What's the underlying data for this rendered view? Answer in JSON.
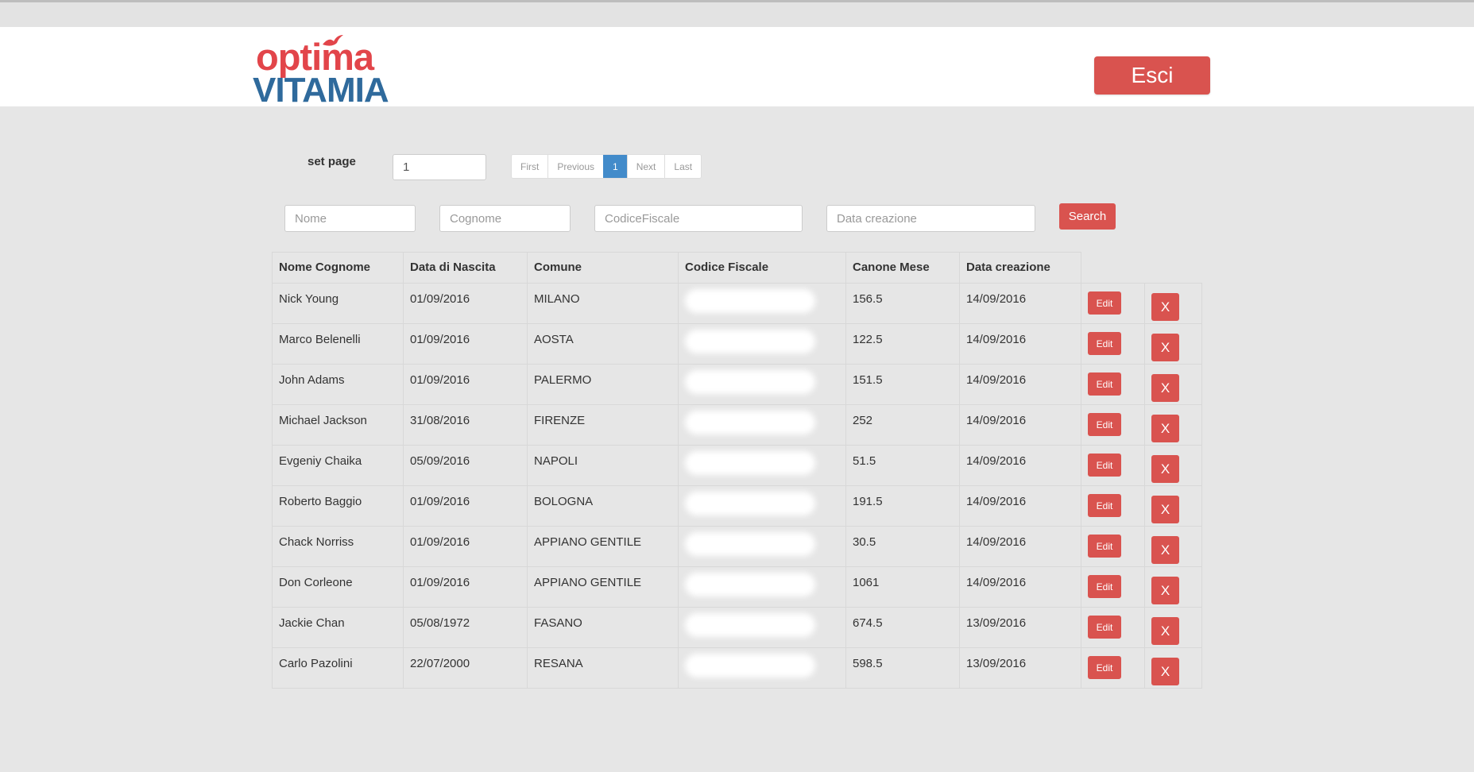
{
  "header": {
    "logo_top": "optima",
    "logo_bottom": "VITAMIA",
    "logout_label": "Esci",
    "colors": {
      "brand_red": "#e2454a",
      "brand_blue": "#2f6a9c",
      "button_red": "#d9534f"
    }
  },
  "pager": {
    "set_page_label": "set page",
    "page_input_value": "1",
    "buttons": [
      "First",
      "Previous",
      "1",
      "Next",
      "Last"
    ],
    "active": "1"
  },
  "filters": {
    "nome_placeholder": "Nome",
    "cognome_placeholder": "Cognome",
    "cf_placeholder": "CodiceFiscale",
    "data_placeholder": "Data creazione",
    "search_label": "Search"
  },
  "table": {
    "columns": [
      "Nome Cognome",
      "Data di Nascita",
      "Comune",
      "Codice Fiscale",
      "Canone Mese",
      "Data creazione"
    ],
    "edit_label": "Edit",
    "delete_label": "X",
    "rows": [
      {
        "name": "Nick Young",
        "birth": "01/09/2016",
        "comune": "MILANO",
        "canone": "156.5",
        "created": "14/09/2016"
      },
      {
        "name": "Marco Belenelli",
        "birth": "01/09/2016",
        "comune": "AOSTA",
        "canone": "122.5",
        "created": "14/09/2016"
      },
      {
        "name": "John Adams",
        "birth": "01/09/2016",
        "comune": "PALERMO",
        "canone": "151.5",
        "created": "14/09/2016"
      },
      {
        "name": "Michael Jackson",
        "birth": "31/08/2016",
        "comune": "FIRENZE",
        "canone": "252",
        "created": "14/09/2016"
      },
      {
        "name": "Evgeniy Chaika",
        "birth": "05/09/2016",
        "comune": "NAPOLI",
        "canone": "51.5",
        "created": "14/09/2016"
      },
      {
        "name": "Roberto Baggio",
        "birth": "01/09/2016",
        "comune": "BOLOGNA",
        "canone": "191.5",
        "created": "14/09/2016"
      },
      {
        "name": "Chack Norriss",
        "birth": "01/09/2016",
        "comune": "APPIANO GENTILE",
        "canone": "30.5",
        "created": "14/09/2016"
      },
      {
        "name": "Don Corleone",
        "birth": "01/09/2016",
        "comune": "APPIANO GENTILE",
        "canone": "1061",
        "created": "14/09/2016"
      },
      {
        "name": "Jackie Chan",
        "birth": "05/08/1972",
        "comune": "FASANO",
        "canone": "674.5",
        "created": "13/09/2016"
      },
      {
        "name": "Carlo Pazolini",
        "birth": "22/07/2000",
        "comune": "RESANA",
        "canone": "598.5",
        "created": "13/09/2016"
      }
    ]
  }
}
